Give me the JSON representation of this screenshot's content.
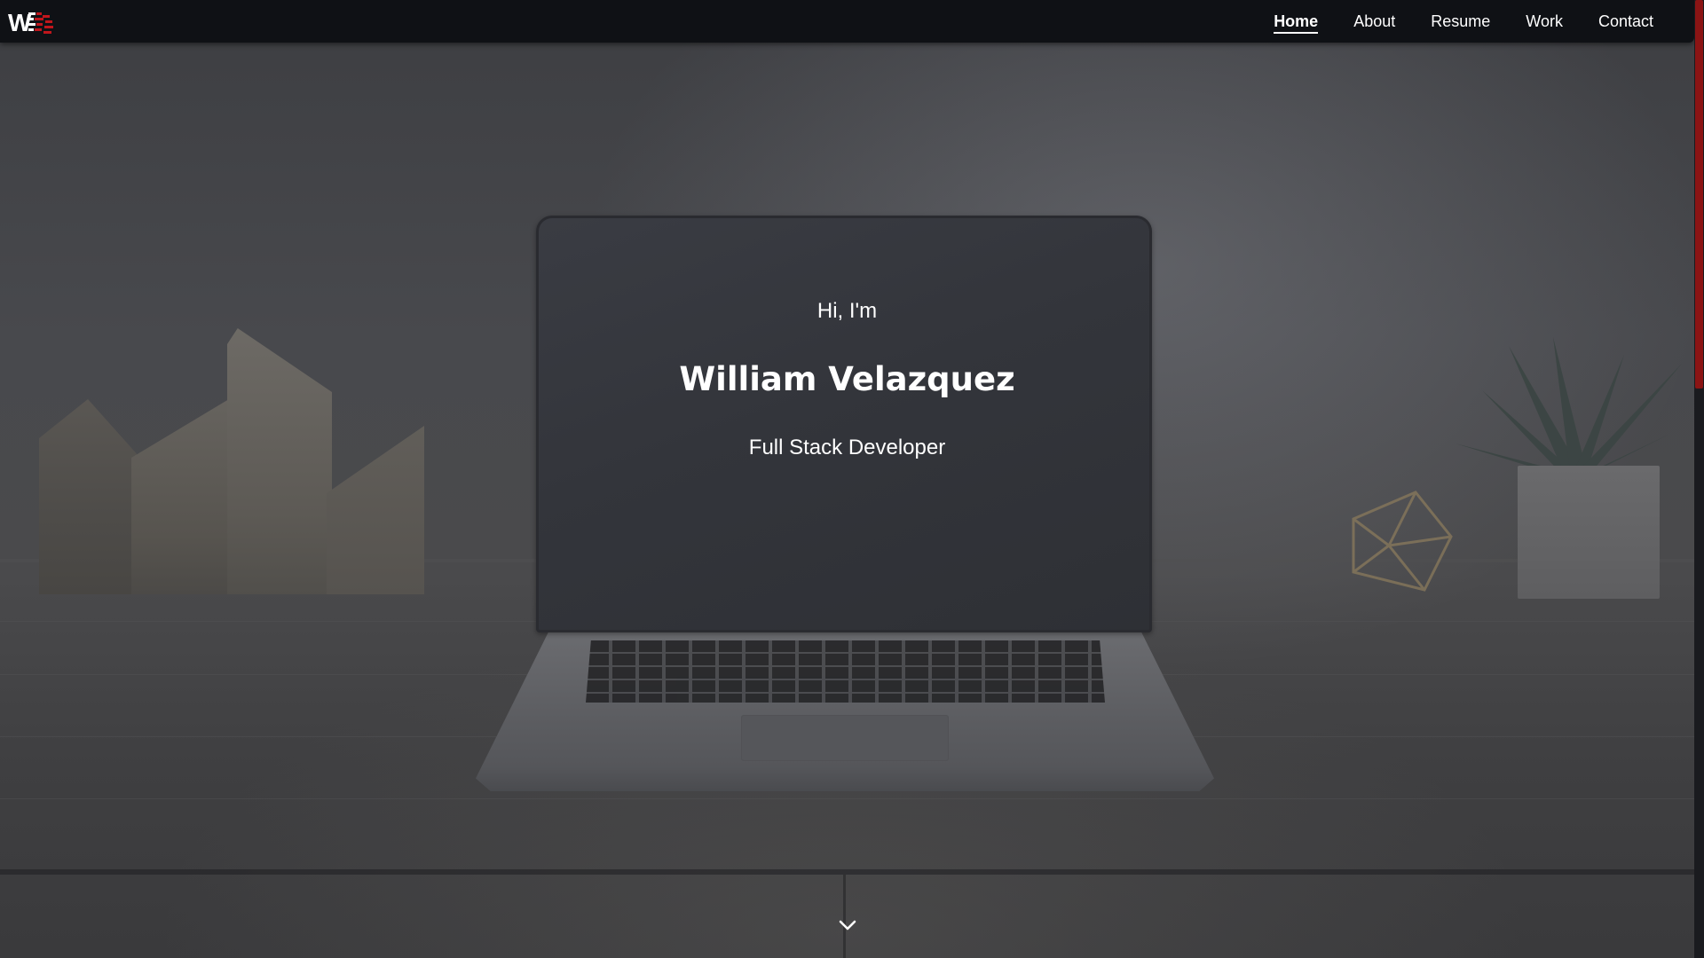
{
  "navbar": {
    "logo_text": "WV",
    "links": [
      {
        "label": "Home",
        "active": true
      },
      {
        "label": "About",
        "active": false
      },
      {
        "label": "Resume",
        "active": false
      },
      {
        "label": "Work",
        "active": false
      },
      {
        "label": "Contact",
        "active": false
      }
    ]
  },
  "hero": {
    "greeting": "Hi, I'm",
    "name": "William Velazquez",
    "role": "Full Stack Developer",
    "scroll_icon": "chevron-down-icon"
  },
  "colors": {
    "navbar_bg": "#0f1115",
    "accent": "#8b1414",
    "text": "#ffffff"
  },
  "icons": {
    "logo": "wv-logo-icon",
    "scroll": "chevron-down-icon"
  }
}
